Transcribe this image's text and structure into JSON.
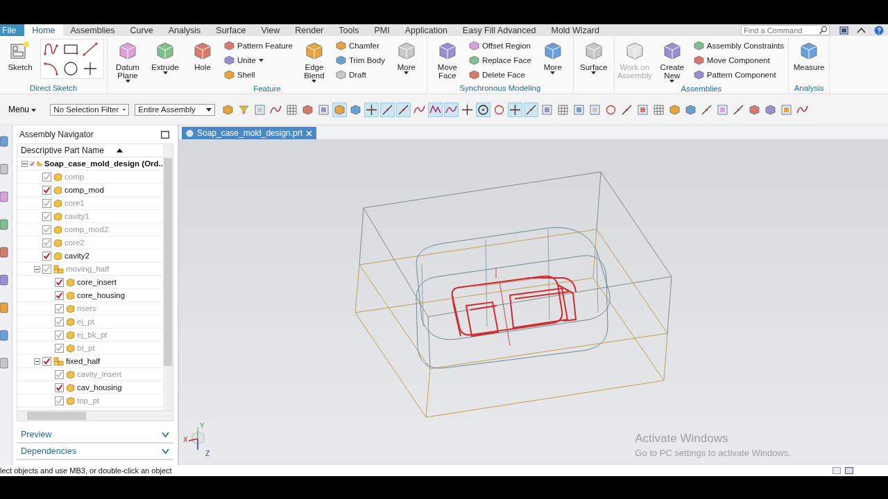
{
  "menu_tabs": [
    {
      "label": "File",
      "kind": "file",
      "selected": false
    },
    {
      "label": "Home",
      "kind": "tab",
      "selected": true
    },
    {
      "label": "Assemblies",
      "kind": "tab",
      "selected": false
    },
    {
      "label": "Curve",
      "kind": "tab",
      "selected": false
    },
    {
      "label": "Analysis",
      "kind": "tab",
      "selected": false
    },
    {
      "label": "Surface",
      "kind": "tab",
      "selected": false
    },
    {
      "label": "View",
      "kind": "tab",
      "selected": false
    },
    {
      "label": "Render",
      "kind": "tab",
      "selected": false
    },
    {
      "label": "Tools",
      "kind": "tab",
      "selected": false
    },
    {
      "label": "PMI",
      "kind": "tab",
      "selected": false
    },
    {
      "label": "Application",
      "kind": "tab",
      "selected": false
    },
    {
      "label": "Easy Fill Advanced",
      "kind": "tab",
      "selected": false
    },
    {
      "label": "Mold Wizard",
      "kind": "tab",
      "selected": false
    }
  ],
  "command_search": {
    "placeholder": "Find a Command"
  },
  "ribbon_groups": [
    {
      "title": "Direct Sketch",
      "columns": [
        [
          {
            "kind": "large",
            "label": "Sketch",
            "dropdown": false,
            "disabled": false
          }
        ],
        [
          {
            "kind": "tool_grid"
          }
        ]
      ]
    },
    {
      "title": "Feature",
      "columns": [
        [
          {
            "kind": "large",
            "label": "Datum Plane",
            "dropdown": true,
            "disabled": false
          }
        ],
        [
          {
            "kind": "large",
            "label": "Extrude",
            "dropdown": true,
            "disabled": false
          }
        ],
        [
          {
            "kind": "large",
            "label": "Hole",
            "dropdown": false,
            "disabled": false
          }
        ],
        [
          {
            "kind": "small",
            "label": "Pattern Feature",
            "dropdown": false,
            "disabled": false
          },
          {
            "kind": "small",
            "label": "Unite",
            "dropdown": true,
            "disabled": false
          },
          {
            "kind": "small",
            "label": "Shell",
            "dropdown": false,
            "disabled": false
          }
        ],
        [
          {
            "kind": "large",
            "label": "Edge Blend",
            "dropdown": true,
            "disabled": false
          }
        ],
        [
          {
            "kind": "small",
            "label": "Chamfer",
            "dropdown": false,
            "disabled": false
          },
          {
            "kind": "small",
            "label": "Trim Body",
            "dropdown": false,
            "disabled": false
          },
          {
            "kind": "small",
            "label": "Draft",
            "dropdown": false,
            "disabled": false
          }
        ],
        [
          {
            "kind": "large",
            "label": "More",
            "dropdown": true,
            "disabled": false
          }
        ]
      ]
    },
    {
      "title": "Synchronous Modeling",
      "columns": [
        [
          {
            "kind": "large",
            "label": "Move Face",
            "dropdown": false,
            "disabled": false
          }
        ],
        [
          {
            "kind": "small",
            "label": "Offset Region",
            "dropdown": false,
            "disabled": false
          },
          {
            "kind": "small",
            "label": "Replace Face",
            "dropdown": false,
            "disabled": false
          },
          {
            "kind": "small",
            "label": "Delete Face",
            "dropdown": false,
            "disabled": false
          }
        ],
        [
          {
            "kind": "large",
            "label": "More",
            "dropdown": true,
            "disabled": false
          }
        ]
      ]
    },
    {
      "columns": [
        [
          {
            "kind": "large",
            "label": "Surface",
            "dropdown": true,
            "disabled": false
          }
        ]
      ]
    },
    {
      "title": "Assemblies",
      "columns": [
        [
          {
            "kind": "large",
            "label": "Work on Assembly",
            "dropdown": false,
            "disabled": true
          }
        ],
        [
          {
            "kind": "large",
            "label": "Create New",
            "dropdown": true,
            "disabled": false
          }
        ],
        [
          {
            "kind": "small",
            "label": "Assembly Constraints",
            "dropdown": false,
            "disabled": false
          },
          {
            "kind": "small",
            "label": "Move Component",
            "dropdown": false,
            "disabled": false
          },
          {
            "kind": "small",
            "label": "Pattern Component",
            "dropdown": false,
            "disabled": false
          }
        ]
      ]
    },
    {
      "title": "Analysis",
      "columns": [
        [
          {
            "kind": "large",
            "label": "Measure",
            "dropdown": false,
            "disabled": false
          }
        ]
      ]
    }
  ],
  "toolbar": {
    "menu": "Menu",
    "selection_filter": "No Selection Filter",
    "scope": "Entire Assembly"
  },
  "toolbar_toggles": [
    {
      "on": false
    },
    {
      "on": false
    },
    {
      "on": false
    },
    {
      "on": false
    },
    {
      "on": false
    },
    {
      "on": false
    },
    {
      "on": false
    },
    {
      "on": true
    },
    {
      "on": false
    },
    {
      "on": true
    },
    {
      "on": true
    },
    {
      "on": true
    },
    {
      "on": false
    },
    {
      "on": true
    },
    {
      "on": true
    },
    {
      "on": false
    },
    {
      "on": true
    },
    {
      "on": false
    },
    {
      "on": true
    },
    {
      "on": true
    },
    {
      "on": false
    },
    {
      "on": false
    },
    {
      "on": false
    },
    {
      "on": false
    },
    {
      "on": false
    },
    {
      "on": false
    },
    {
      "on": false
    },
    {
      "on": false
    },
    {
      "on": false
    },
    {
      "on": false
    },
    {
      "on": false
    },
    {
      "on": false
    },
    {
      "on": false
    },
    {
      "on": false
    },
    {
      "on": false
    },
    {
      "on": false
    },
    {
      "on": false
    }
  ],
  "navigator": {
    "title": "Assembly Navigator",
    "column": "Descriptive Part Name",
    "tree": [
      {
        "label": "Soap_case_mold_design (Ord..",
        "checked": true,
        "expanded": true,
        "children": [
          {
            "label": "comp",
            "checked": false
          },
          {
            "label": "comp_mod",
            "checked": true
          },
          {
            "label": "core1",
            "checked": false
          },
          {
            "label": "cavity1",
            "checked": false
          },
          {
            "label": "comp_mod2",
            "checked": false
          },
          {
            "label": "core2",
            "checked": false
          },
          {
            "label": "cavity2",
            "checked": true
          },
          {
            "label": "moving_half",
            "checked": false,
            "expanded": true,
            "children": [
              {
                "label": "core_insert",
                "checked": true
              },
              {
                "label": "core_housing",
                "checked": true
              },
              {
                "label": "risers",
                "checked": false
              },
              {
                "label": "ej_pt",
                "checked": false
              },
              {
                "label": "ej_bk_pt",
                "checked": false
              },
              {
                "label": "bt_pt",
                "checked": false
              }
            ]
          },
          {
            "label": "fixed_half",
            "checked": true,
            "expanded": true,
            "children": [
              {
                "label": "cavity_insert",
                "checked": false
              },
              {
                "label": "cav_housing",
                "checked": true
              },
              {
                "label": "top_pt",
                "checked": false
              }
            ]
          }
        ]
      }
    ],
    "panels": [
      {
        "label": "Preview",
        "expanded": false
      },
      {
        "label": "Dependencies",
        "expanded": false
      }
    ]
  },
  "graphics_tabs": [
    {
      "label": "Soap_case_mold_design.prt",
      "selected": true
    }
  ],
  "triad": {
    "x": "X",
    "y": "Y",
    "z": "Z"
  },
  "os_notice": {
    "title": "Activate Windows",
    "text": "Go to PC settings to activate Windows."
  },
  "status_bar": "lect objects and use MB3, or double-click an object"
}
